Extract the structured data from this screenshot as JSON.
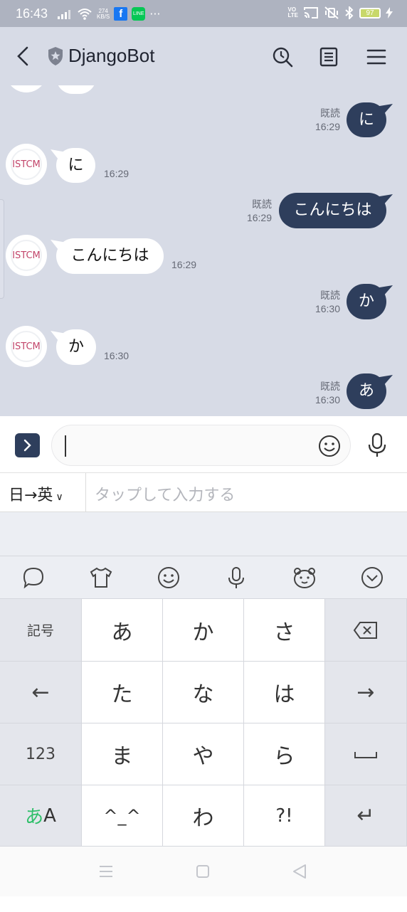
{
  "status_bar": {
    "time": "16:43",
    "speed_value": "274",
    "speed_unit": "KB/S",
    "more": "···",
    "volte": "VO\nLTE",
    "battery": "97",
    "line_icon_text": "LINE"
  },
  "header": {
    "title": "DjangoBot"
  },
  "messages": {
    "out_ni": {
      "text": "に",
      "read": "既読",
      "time": "16:29"
    },
    "in_ni": {
      "text": "に",
      "time": "16:29"
    },
    "out_konnichiwa": {
      "text": "こんにちは",
      "read": "既読",
      "time": "16:29"
    },
    "in_konnichiwa": {
      "text": "こんにちは",
      "time": "16:29"
    },
    "out_ka": {
      "text": "か",
      "read": "既読",
      "time": "16:30"
    },
    "in_ka": {
      "text": "か",
      "time": "16:30"
    },
    "out_a": {
      "text": "あ",
      "read": "既読",
      "time": "16:30"
    }
  },
  "avatar_text": "ISTCM",
  "input": {
    "value": ""
  },
  "translation": {
    "direction": "日→英",
    "placeholder": "タップして入力する"
  },
  "keyboard": {
    "row1": {
      "left": "記号",
      "k1": "あ",
      "k2": "か",
      "k3": "さ"
    },
    "row2": {
      "left": "←",
      "k1": "た",
      "k2": "な",
      "k3": "は",
      "right": "→"
    },
    "row3": {
      "left": "123",
      "k1": "ま",
      "k2": "や",
      "k3": "ら",
      "right": "␣"
    },
    "row4": {
      "left_green": "あ",
      "left_black": "A",
      "k1": "^_^",
      "k2": "わ",
      "k3": "?!",
      "right": "↵"
    }
  },
  "colors": {
    "chat_bg": "#d7dbe6",
    "outgoing_bubble": "#2e3e5c",
    "incoming_bubble": "#ffffff",
    "status_bar": "#aeb3c0",
    "green_accent": "#2fbf6a"
  }
}
